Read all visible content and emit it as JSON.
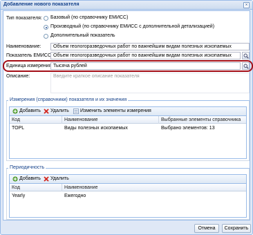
{
  "window": {
    "title": "Добавление нового показателя"
  },
  "form": {
    "type_label": "Тип показателя:",
    "radio_options": [
      {
        "label": "Базовый (по справочнику ЕМИСС)",
        "checked": false
      },
      {
        "label": "Производный (по справочнику ЕМИСС с дополнительной детализацией)",
        "checked": true
      },
      {
        "label": "Дополнительный показатель",
        "checked": false
      }
    ],
    "name_label": "Наименование:",
    "name_value": "Объем геологоразведочных работ по важнейшим видам полезных ископаемых",
    "emiss_label": "Показатель ЕМИСС:",
    "emiss_value": "Объем геологоразведочных работ по важнейшим видам полезных ископаемых",
    "unit_label": "Единица измерения:",
    "unit_value": "Тысяча рублей",
    "desc_label": "Описание:",
    "desc_placeholder": "Введите краткое описание показателя"
  },
  "dimensions_section": {
    "legend": "Измерения (справочники) показателя и их значения",
    "toolbar": {
      "add": "Добавить",
      "delete": "Удалить",
      "edit": "Изменить элементы измерения"
    },
    "columns": [
      "Код",
      "Наименование",
      "Выбранные элементы справочника"
    ],
    "rows": [
      {
        "code": "TOPL",
        "name": "Виды полезных ископаемых",
        "selected": "Выбрано элементов: 13"
      }
    ]
  },
  "periodicity_section": {
    "legend": "Периодичность",
    "toolbar": {
      "add": "Добавить",
      "delete": "Удалить"
    },
    "columns": [
      "Код",
      "Наименование"
    ],
    "rows": [
      {
        "code": "Yearly",
        "name": "Ежегодно"
      }
    ]
  },
  "footer": {
    "cancel": "Отмена",
    "save": "Сохранить"
  },
  "colors": {
    "accent": "#15428b",
    "highlight": "#a30d16",
    "border": "#99bbe8"
  }
}
